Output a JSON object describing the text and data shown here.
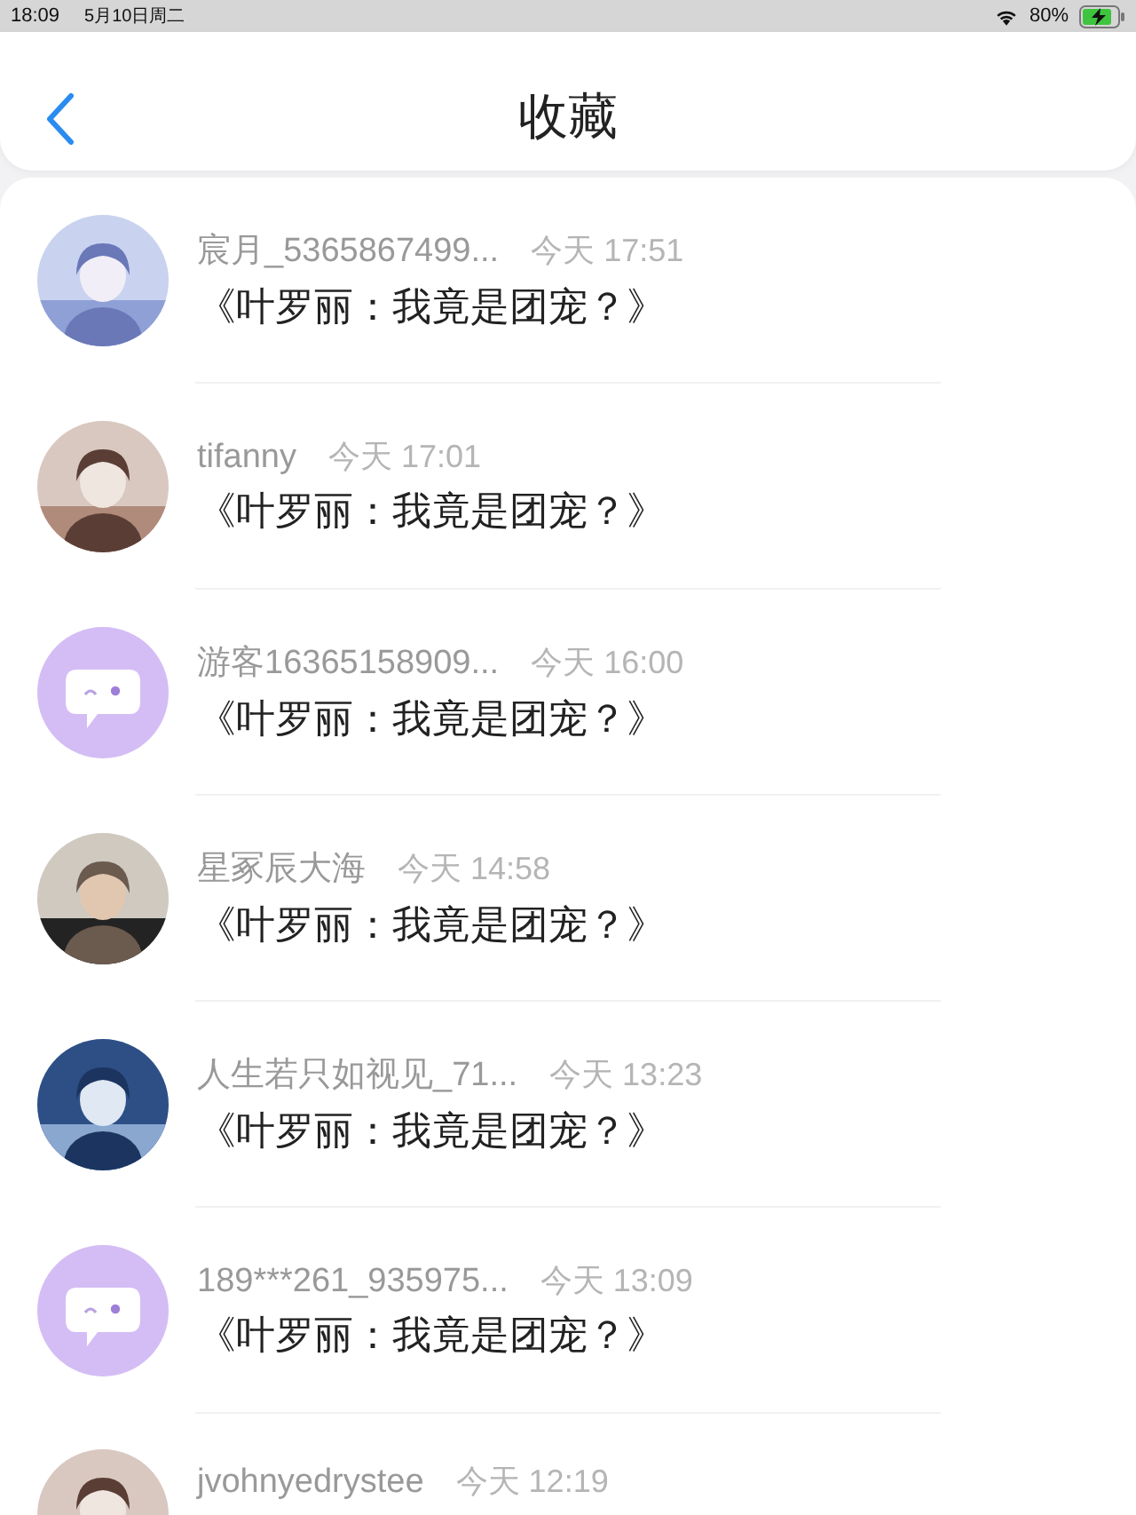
{
  "status_bar": {
    "time": "18:09",
    "date": "5月10日周二",
    "battery": "80%"
  },
  "header": {
    "title": "收藏"
  },
  "items": [
    {
      "name": "宸月_5365867499...",
      "time": "今天 17:51",
      "title": "《叶罗丽：我竟是团宠？》"
    },
    {
      "name": "tifanny",
      "time": "今天 17:01",
      "title": "《叶罗丽：我竟是团宠？》"
    },
    {
      "avatar": {
        "kind": "default"
      },
      "name": "游客16365158909...",
      "time": "今天 16:00",
      "title": "《叶罗丽：我竟是团宠？》"
    },
    {
      "name": "星冢辰大海",
      "time": "今天 14:58",
      "title": "《叶罗丽：我竟是团宠？》"
    },
    {
      "name": "人生若只如视见_71...",
      "time": "今天 13:23",
      "title": "《叶罗丽：我竟是团宠？》"
    },
    {
      "avatar": {
        "kind": "default"
      },
      "name": "189***261_935975...",
      "time": "今天 13:09",
      "title": "《叶罗丽：我竟是团宠？》"
    },
    {
      "name": "jvohnyedrystee",
      "time": "今天 12:19"
    }
  ]
}
